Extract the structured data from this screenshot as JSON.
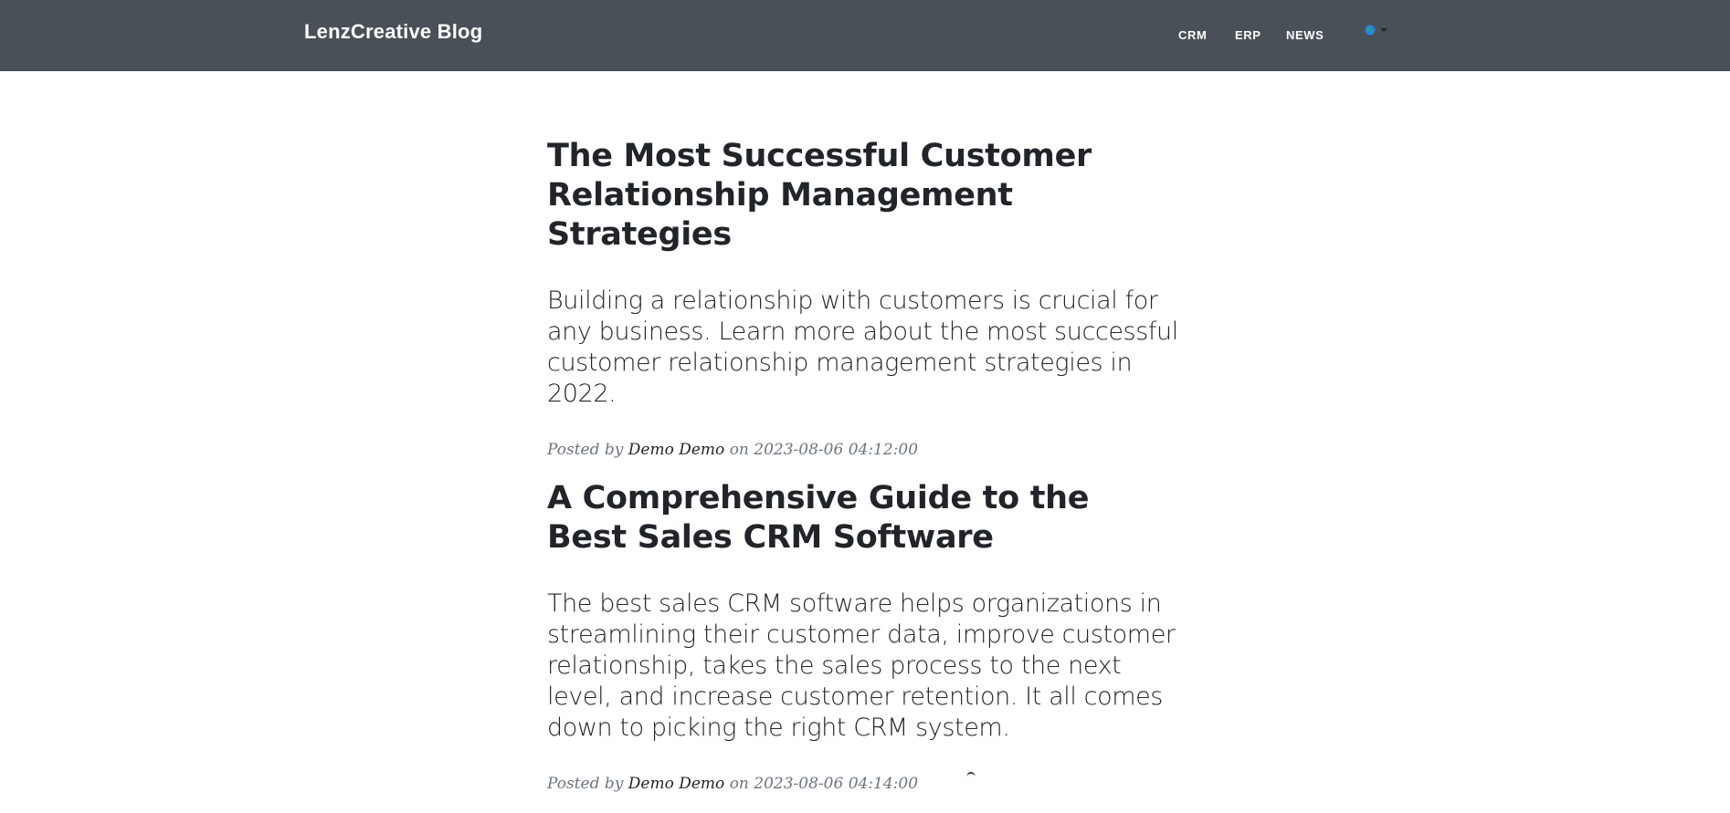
{
  "navbar": {
    "brand": "LenzCreative Blog",
    "links": [
      "CRM",
      "ERP",
      "NEWS"
    ],
    "language_icon": "globe-icon",
    "language_caret": "caret-down-icon"
  },
  "posts": [
    {
      "title": "The Most Successful Customer Relationship Management Strategies",
      "subtitle": "Building a relationship with customers is crucial for any business. Learn more about the most successful customer relationship management strategies in 2022.",
      "meta_prefix": "Posted by",
      "author": "Demo Demo",
      "meta_on": "on",
      "date": "2023-08-06 04:12:00"
    },
    {
      "title": "A Comprehensive Guide to the Best Sales CRM Software",
      "subtitle": "The best sales CRM software helps organizations in streamlining their customer data, improve customer relationship, takes the sales process to the next level, and increase customer retention. It all comes down to picking the right CRM system.",
      "meta_prefix": "Posted by",
      "author": "Demo Demo",
      "meta_on": "on",
      "date": "2023-08-06 04:14:00"
    }
  ],
  "colors": {
    "navbar_bg": "#495057",
    "text": "#212529",
    "meta": "#6c757d"
  }
}
